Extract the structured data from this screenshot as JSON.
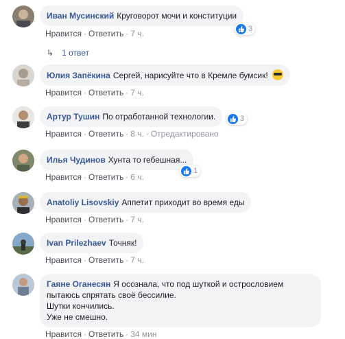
{
  "labels": {
    "like": "Нравится",
    "reply": "Ответить",
    "sep": "·"
  },
  "reply_link": "1 ответ",
  "comments": [
    {
      "author": "Иван Мусинский",
      "text": "Круговорот мочи и конституции",
      "time": "7 ч.",
      "reactions": "3"
    },
    {
      "author": "Юлия Запёкина",
      "text": "Сергей, нарисуйте что в Кремле бумсик!",
      "time": "7 ч."
    },
    {
      "author": "Артур Тушин",
      "text": "По отработанной технологии.",
      "time": "8 ч.",
      "edited": "Отредактировано",
      "reactions": "3"
    },
    {
      "author": "Илья Чудинов",
      "text": "Хунта то гебешная...",
      "time": "6 ч.",
      "reactions": "1"
    },
    {
      "author": "Anatoliy Lisovskiy",
      "text": "Аппетит приходит во время еды",
      "time": "7 ч."
    },
    {
      "author": "Ivan Prilezhaev",
      "text": "Точняк!",
      "time": "7 ч."
    },
    {
      "author": "Гаяне Оганесян",
      "text_lines": [
        "Я осознала, что под шуткой и острословием",
        "пытаюсь спрятать своё бессилие.",
        "Шутки кончились.",
        "Уже не смешно."
      ],
      "time": "34 мин"
    }
  ],
  "colors": {
    "author": "#385898",
    "bubble": "#f2f3f5",
    "meta": "#90949c",
    "like": "#1877f2"
  }
}
